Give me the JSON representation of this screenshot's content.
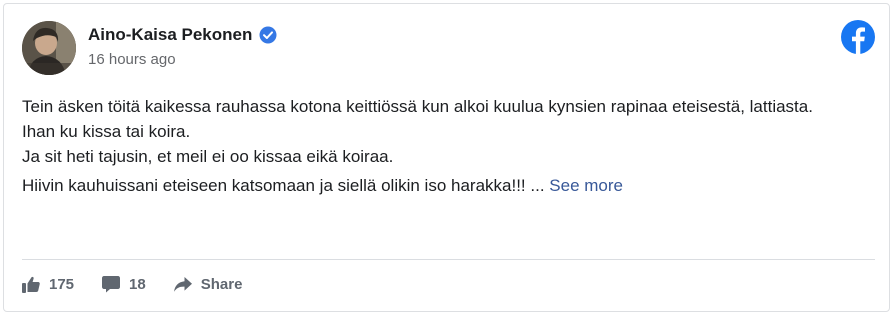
{
  "post": {
    "author_name": "Aino-Kaisa Pekonen",
    "timestamp": "16 hours ago",
    "paragraphs": [
      "Tein äsken töitä kaikessa rauhassa kotona keittiössä kun alkoi kuulua kynsien rapinaa eteisestä, lattiasta.\nIhan ku kissa tai koira.\nJa sit heti tajusin, et meil ei oo kissaa eikä koiraa.",
      "Hiivin kauhuissani eteiseen katsomaan ja siellä olikin iso harakka!!! ..."
    ],
    "see_more_label": "See more"
  },
  "actions": {
    "like_count": "175",
    "comment_count": "18",
    "share_label": "Share"
  },
  "icons": {
    "verified": "verified-badge-icon",
    "facebook": "facebook-logo-icon",
    "like": "thumbs-up-icon",
    "comment": "comment-bubble-icon",
    "share": "share-arrow-icon"
  },
  "colors": {
    "facebook_blue": "#1877f2",
    "link_blue": "#385898",
    "verified_blue": "#3578e5",
    "muted_text": "#65676b"
  }
}
